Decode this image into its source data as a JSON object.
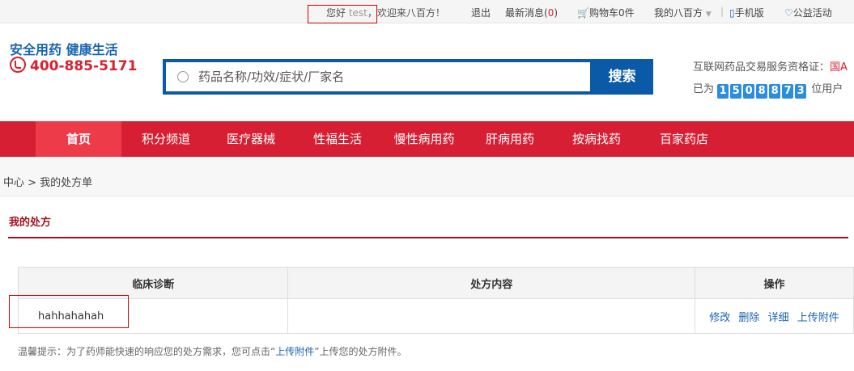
{
  "topbar": {
    "greeting": "您好",
    "username": "test",
    "welcome": "，欢迎来八百方！",
    "logout": "退出",
    "messages_label": "最新消息(",
    "messages_count": "0",
    "messages_close": ")",
    "cart": "购物车0件",
    "my_account": "我的八百方",
    "mobile": "手机版",
    "charity": "公益活动"
  },
  "header": {
    "slogan": "安全用药 健康生活",
    "phone": "400-885-5171",
    "qualification_label": "互联网药品交易服务资格证：",
    "qualification_value": "国A",
    "served_prefix": "已为",
    "served_digits": [
      "1",
      "5",
      "0",
      "8",
      "8",
      "7",
      "3"
    ],
    "served_suffix": "位用户"
  },
  "search": {
    "placeholder": "药品名称/功效/症状/厂家名",
    "button": "搜索"
  },
  "nav": {
    "items": [
      "首页",
      "积分频道",
      "医疗器械",
      "性福生活",
      "慢性病用药",
      "肝病用药",
      "按病找药",
      "百家药店"
    ]
  },
  "breadcrumb": {
    "text": "中心 > 我的处方单"
  },
  "page": {
    "title": "我的处方"
  },
  "table": {
    "headers": [
      "临床诊断",
      "处方内容",
      "操作"
    ],
    "rows": [
      {
        "diagnosis": "hahhahahah",
        "content": "",
        "actions": [
          "修改",
          "删除",
          "详细",
          "上传附件"
        ]
      }
    ]
  },
  "tip": {
    "prefix": "温馨提示：为了药师能快速的响应您的处方需求，您可点击“",
    "link": "上传附件",
    "suffix": "”上传您的处方附件。"
  },
  "colors": {
    "brand_blue": "#0a5aa8",
    "nav_red": "#d71f33",
    "title_red": "#a0141f",
    "link_blue": "#1a65b2"
  }
}
